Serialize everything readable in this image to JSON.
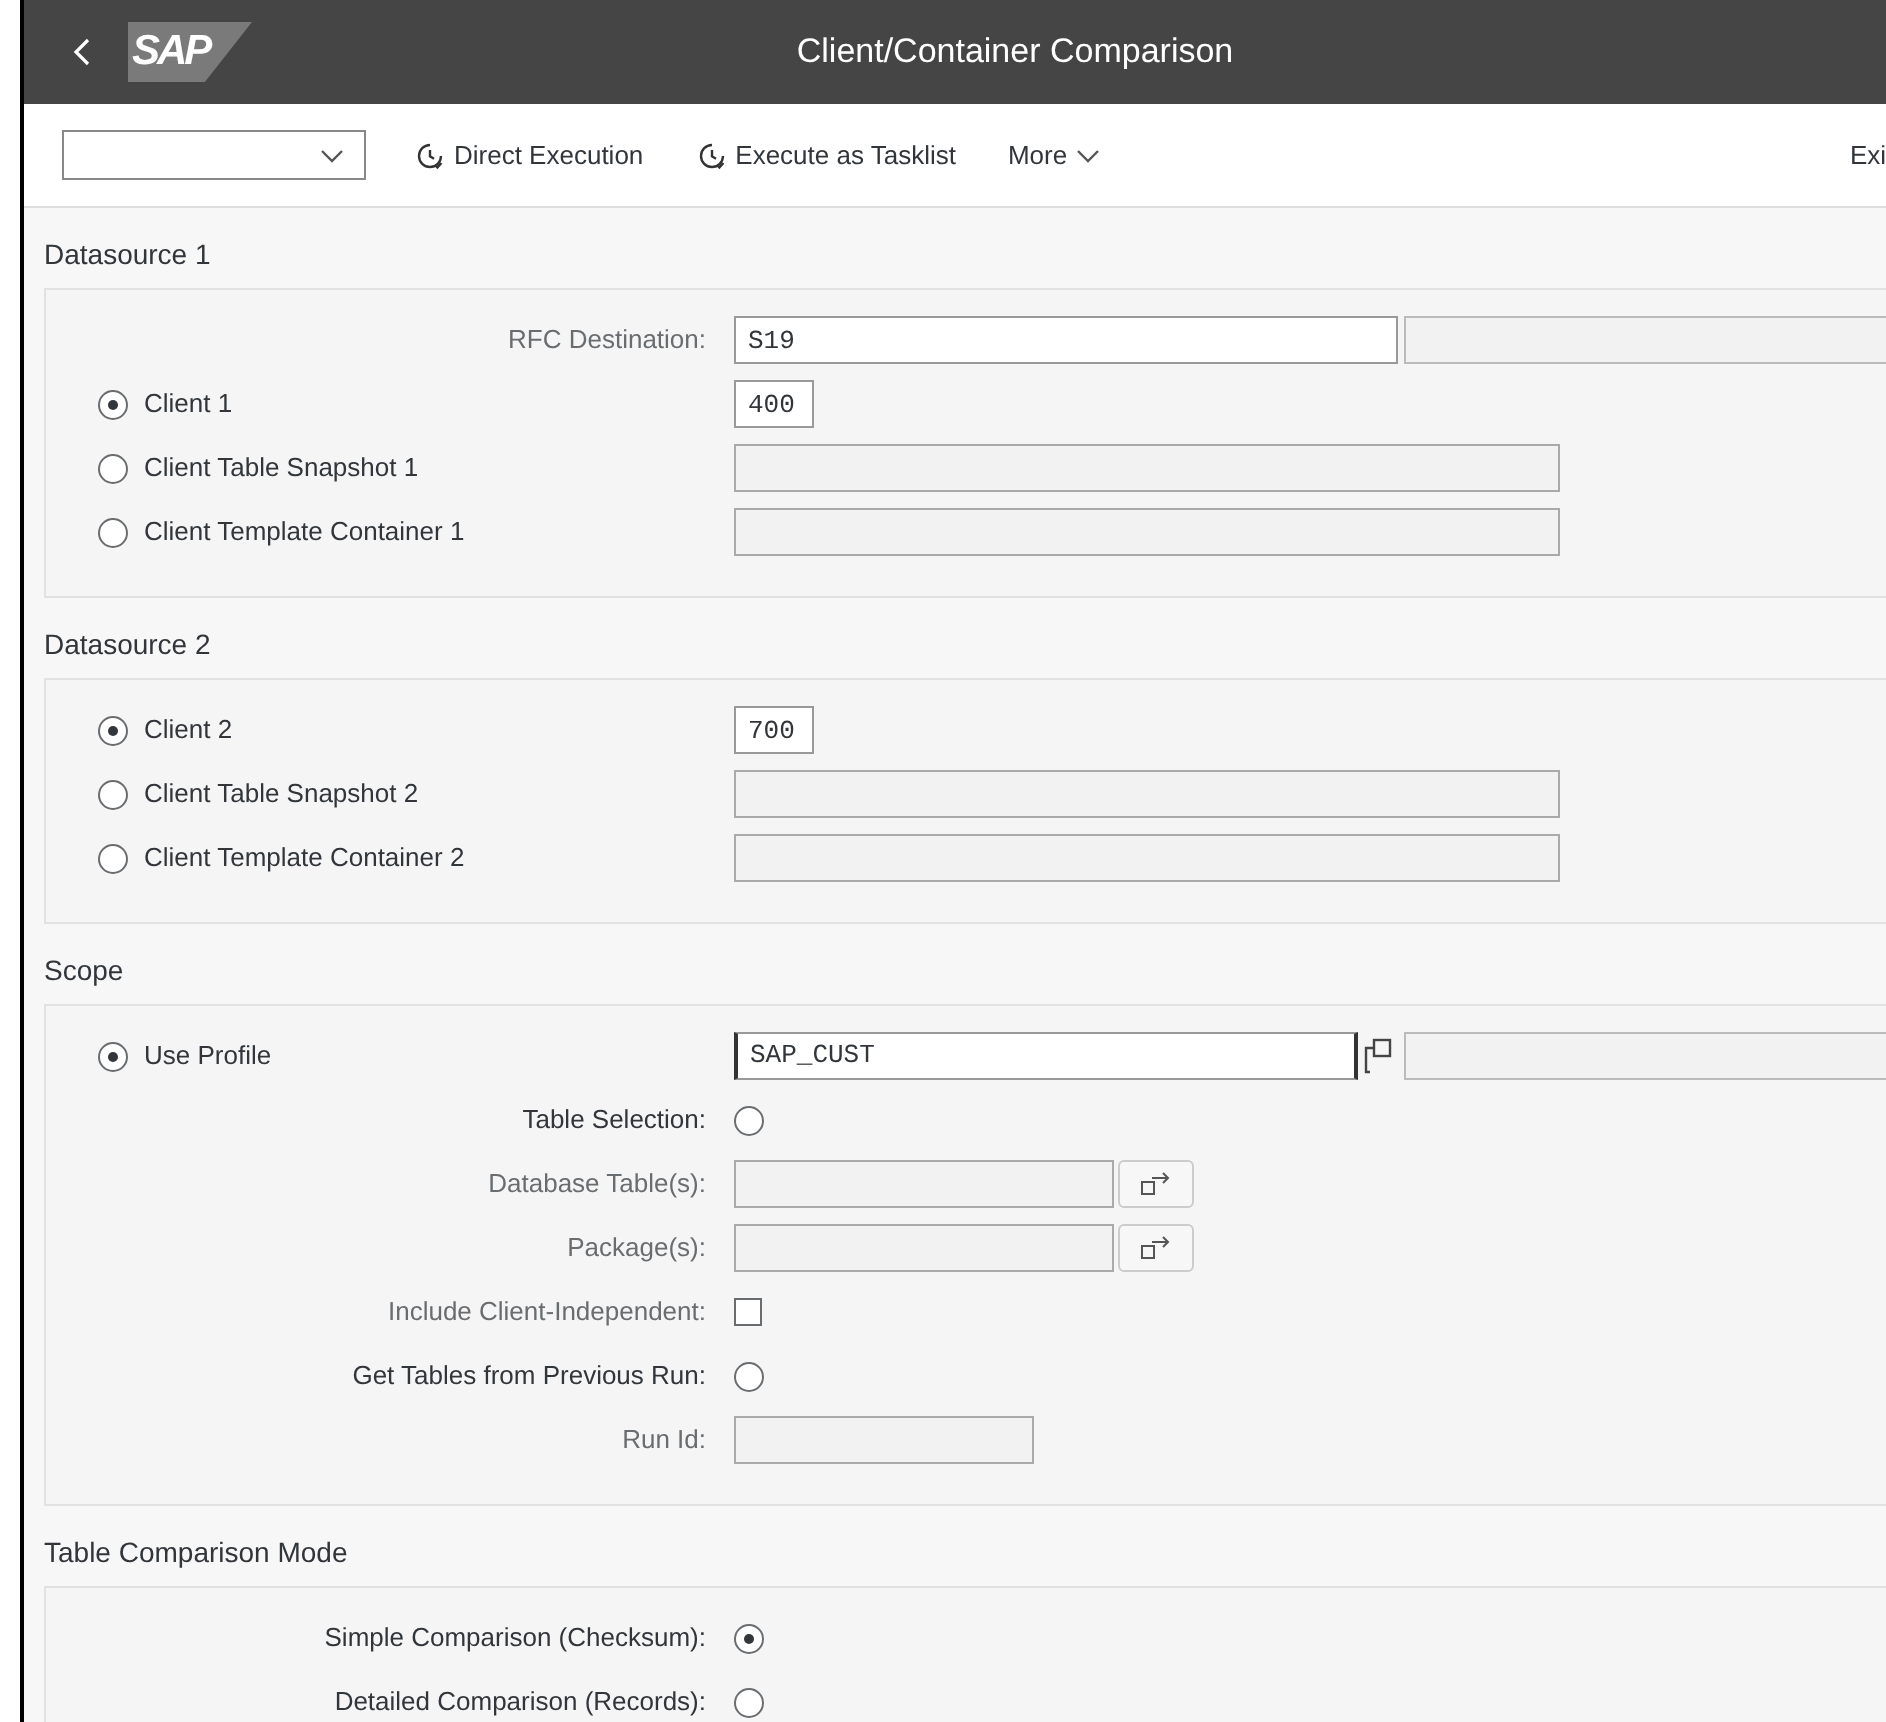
{
  "header": {
    "logo": "SAP",
    "title": "Client/Container Comparison"
  },
  "toolbar": {
    "actions": [
      {
        "kind": "execute",
        "label": "Direct Execution"
      },
      {
        "kind": "execute",
        "label": "Execute as Tasklist"
      },
      {
        "kind": "menu",
        "label": "More"
      }
    ],
    "exit": "Exi"
  },
  "sections": [
    {
      "title": "Datasource 1",
      "rows": [
        {
          "kind": "field",
          "label": "RFC Destination:",
          "disabled": true,
          "value": "S19"
        },
        {
          "kind": "radio_short",
          "label": "Client 1",
          "selected": true,
          "value": "400"
        },
        {
          "kind": "radio_long",
          "label": "Client Table Snapshot 1",
          "selected": false
        },
        {
          "kind": "radio_long",
          "label": "Client Template Container 1",
          "selected": false
        }
      ]
    },
    {
      "title": "Datasource 2",
      "rows": [
        {
          "kind": "radio_short",
          "label": "Client 2",
          "selected": true,
          "value": "700"
        },
        {
          "kind": "radio_long",
          "label": "Client Table Snapshot 2",
          "selected": false
        },
        {
          "kind": "radio_long",
          "label": "Client Template Container 2",
          "selected": false
        }
      ]
    },
    {
      "title": "Scope",
      "rows": [
        {
          "kind": "radio_profile",
          "label": "Use Profile",
          "selected": true,
          "value": "SAP_CUST"
        },
        {
          "kind": "label_radio",
          "label": "Table Selection:",
          "disabled": false,
          "selected": false
        },
        {
          "kind": "label_field_button",
          "label": "Database Table(s):",
          "disabled": true
        },
        {
          "kind": "label_field_button",
          "label": "Package(s):",
          "disabled": true
        },
        {
          "kind": "label_checkbox",
          "label": "Include Client-Independent:",
          "disabled": true,
          "checked": false
        },
        {
          "kind": "label_radio",
          "label": "Get Tables from Previous Run:",
          "disabled": false,
          "selected": false
        },
        {
          "kind": "label_field",
          "label": "Run Id:",
          "disabled": true
        }
      ]
    },
    {
      "title": "Table Comparison Mode",
      "rows": [
        {
          "kind": "label_radio",
          "label": "Simple Comparison (Checksum):",
          "disabled": false,
          "selected": true
        },
        {
          "kind": "label_radio",
          "label": "Detailed Comparison (Records):",
          "disabled": false,
          "selected": false
        }
      ]
    }
  ]
}
